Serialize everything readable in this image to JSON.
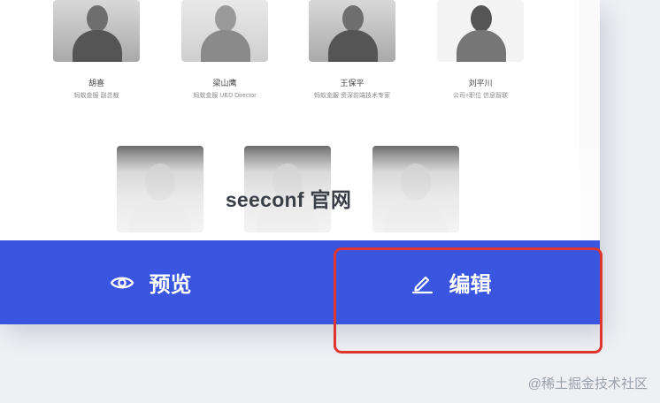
{
  "speakers": [
    {
      "name": "胡喜",
      "title": "蚂蚁金服 副总裁"
    },
    {
      "name": "梁山鹰",
      "title": "蚂蚁金服 UED Director"
    },
    {
      "name": "王保平",
      "title": "蚂蚁金服 资深前端技术专家"
    },
    {
      "name": "刘平川",
      "title": "公司+职位 信息智联"
    }
  ],
  "site_label": "seeconf 官网",
  "actions": {
    "preview_label": "预览",
    "edit_label": "编辑"
  },
  "icons": {
    "preview": "eye-icon",
    "edit": "pencil-icon"
  },
  "colors": {
    "action_bar": "#3a55e0",
    "highlight": "#e0342e"
  },
  "watermark": "@稀土掘金技术社区"
}
